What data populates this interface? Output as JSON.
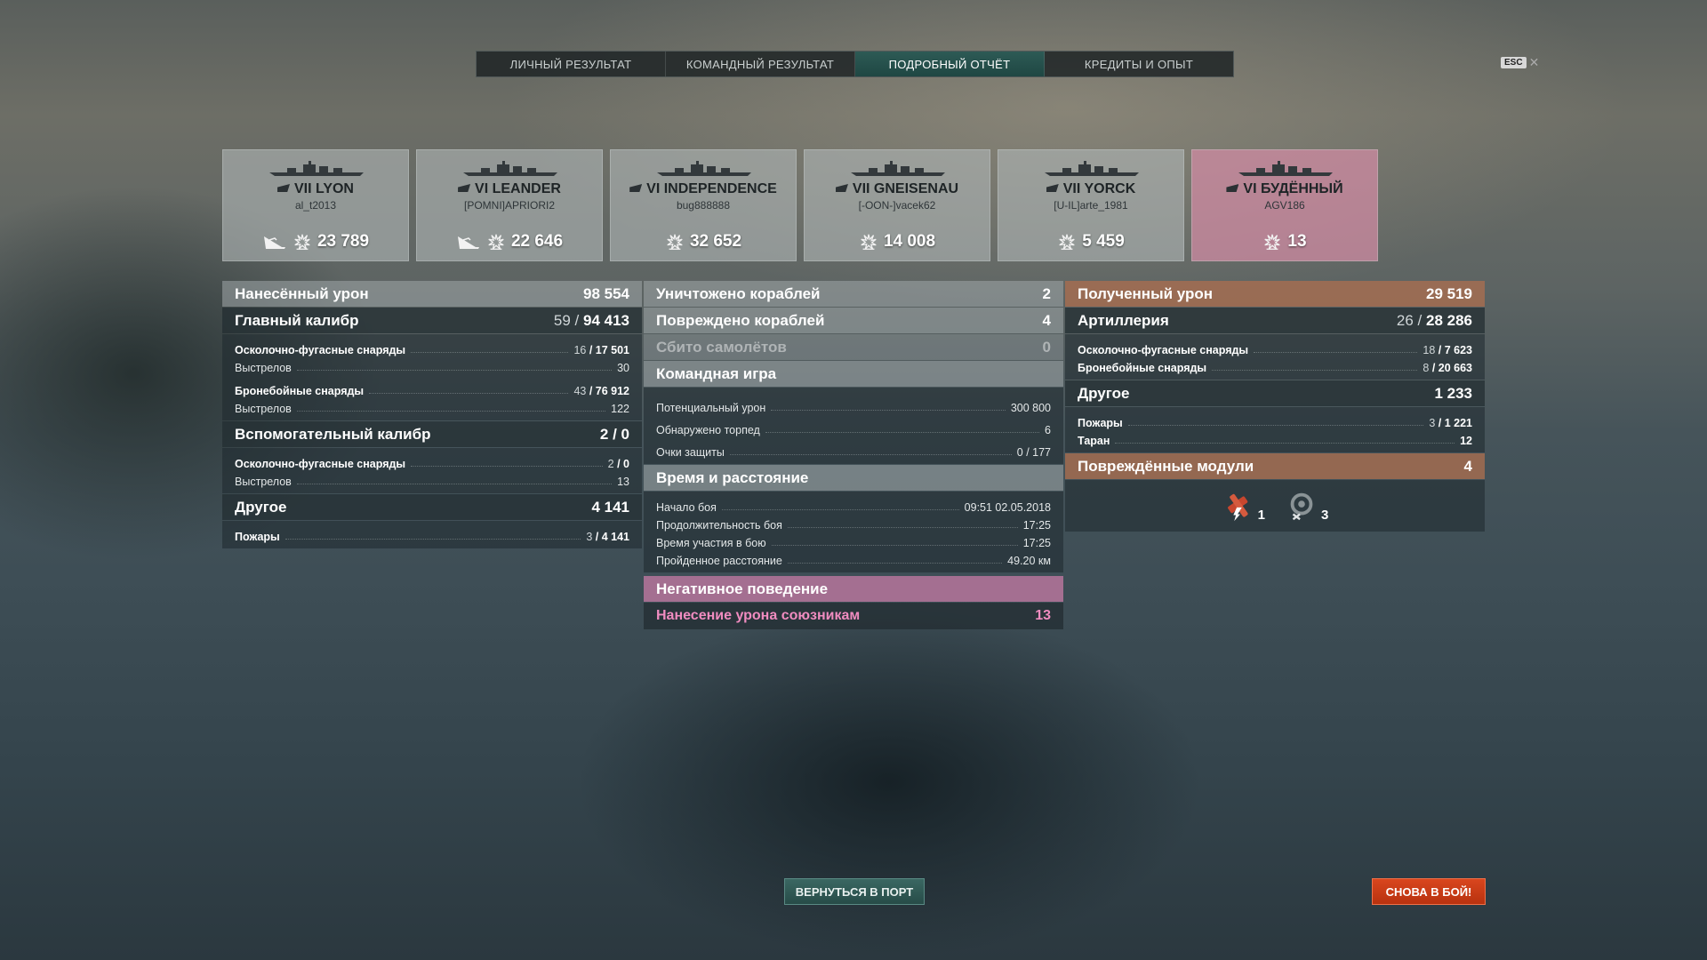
{
  "tabs": [
    {
      "label": "ЛИЧНЫЙ РЕЗУЛЬТАТ",
      "active": false
    },
    {
      "label": "КОМАНДНЫЙ РЕЗУЛЬТАТ",
      "active": false
    },
    {
      "label": "ПОДРОБНЫЙ ОТЧЁТ",
      "active": true
    },
    {
      "label": "КРЕДИТЫ И ОПЫТ",
      "active": false
    }
  ],
  "close": {
    "key": "ESC",
    "icon": "close-icon"
  },
  "ships": [
    {
      "name": "VII LYON",
      "player": "al_t2013",
      "damage": "23 789",
      "plane": true,
      "enemy": false
    },
    {
      "name": "VI LEANDER",
      "player": "[POMNI]APRIORI2",
      "damage": "22 646",
      "plane": true,
      "enemy": false
    },
    {
      "name": "VI INDEPENDENCE",
      "player": "bug888888",
      "damage": "32 652",
      "plane": false,
      "enemy": false
    },
    {
      "name": "VII GNEISENAU",
      "player": "[-OON-]vacek62",
      "damage": "14 008",
      "plane": false,
      "enemy": false
    },
    {
      "name": "VII YORCK",
      "player": "[U-IL]arte_1981",
      "damage": "5 459",
      "plane": false,
      "enemy": false
    },
    {
      "name": "VI БУДЁННЫЙ",
      "player": "AGV186",
      "damage": "13",
      "plane": false,
      "enemy": true
    }
  ],
  "left": {
    "dealt": {
      "label": "Нанесённый урон",
      "value": "98 554"
    },
    "main": {
      "label": "Главный калибр",
      "value_a": "59",
      "value_b": "94 413"
    },
    "main_rows": [
      {
        "label": "Осколочно-фугасные снаряды",
        "a": "16",
        "b": "17 501",
        "bold": true
      },
      {
        "label": "Выстрелов",
        "v": "30",
        "bold": false
      },
      {
        "label": "Бронебойные снаряды",
        "a": "43",
        "b": "76 912",
        "bold": true
      },
      {
        "label": "Выстрелов",
        "v": "122",
        "bold": false
      }
    ],
    "secondary": {
      "label": "Вспомогательный калибр",
      "value": "2 / 0"
    },
    "secondary_rows": [
      {
        "label": "Осколочно-фугасные снаряды",
        "a": "2",
        "b": "0",
        "bold": true
      },
      {
        "label": "Выстрелов",
        "v": "13",
        "bold": false
      }
    ],
    "other": {
      "label": "Другое",
      "value": "4 141"
    },
    "other_rows": [
      {
        "label": "Пожары",
        "a": "3",
        "b": "4 141",
        "bold": true
      }
    ]
  },
  "middle": {
    "destroyed": {
      "label": "Уничтожено кораблей",
      "value": "2"
    },
    "damaged": {
      "label": "Повреждено кораблей",
      "value": "4"
    },
    "planes": {
      "label": "Сбито самолётов",
      "value": "0"
    },
    "team": {
      "label": "Командная игра"
    },
    "team_rows": [
      {
        "label": "Потенциальный урон",
        "v": "300 800"
      },
      {
        "label": "Обнаружено торпед",
        "v": "6"
      },
      {
        "label": "Очки защиты",
        "v": "0 / 177"
      }
    ],
    "time": {
      "label": "Время и расстояние"
    },
    "time_rows": [
      {
        "label": "Начало боя",
        "v": "09:51  02.05.2018"
      },
      {
        "label": "Продолжительность боя",
        "v": "17:25"
      },
      {
        "label": "Время участия в бою",
        "v": "17:25"
      },
      {
        "label": "Пройденное расстояние",
        "v": "49.20 км"
      }
    ],
    "negative": {
      "label": "Негативное поведение"
    },
    "teamdamage": {
      "label": "Нанесение урона союзникам",
      "value": "13"
    }
  },
  "right": {
    "received": {
      "label": "Полученный урон",
      "value": "29 519"
    },
    "artillery": {
      "label": "Артиллерия",
      "value_a": "26",
      "value_b": "28 286"
    },
    "artillery_rows": [
      {
        "label": "Осколочно-фугасные снаряды",
        "a": "18",
        "b": "7 623"
      },
      {
        "label": "Бронебойные снаряды",
        "a": "8",
        "b": "20 663"
      }
    ],
    "other": {
      "label": "Другое",
      "value": "1 233"
    },
    "other_rows": [
      {
        "label": "Пожары",
        "a": "3",
        "b": "1 221"
      },
      {
        "label": "Таран",
        "v": "12"
      }
    ],
    "modules": {
      "label": "Повреждённые модули",
      "value": "4"
    },
    "module_icons": [
      {
        "icon": "steering-gear-icon",
        "count": "1"
      },
      {
        "icon": "engine-icon",
        "count": "3"
      }
    ]
  },
  "buttons": {
    "port": "ВЕРНУТЬСЯ В ПОРТ",
    "battle": "СНОВА В БОЙ!"
  }
}
